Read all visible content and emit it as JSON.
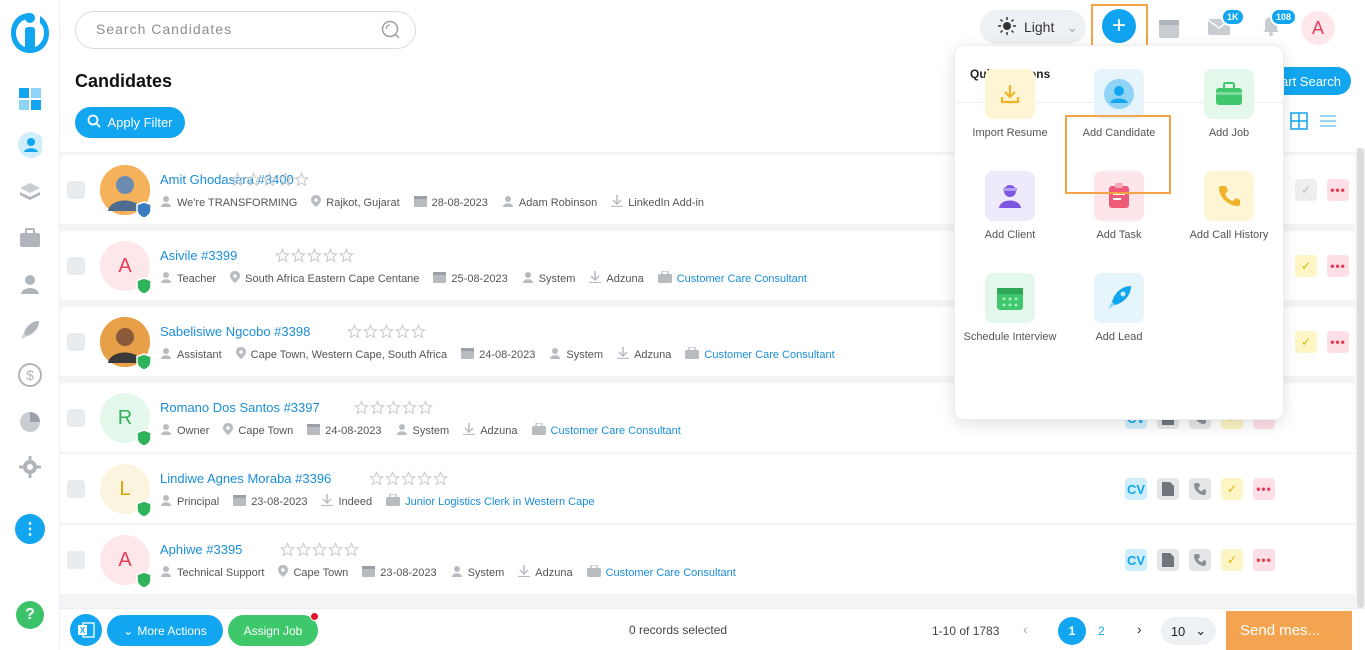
{
  "header": {
    "search_placeholder": "Search Candidates",
    "theme_label": "Light",
    "mail_badge": "1K",
    "notif_badge": "108",
    "avatar_letter": "A"
  },
  "page": {
    "title": "Candidates",
    "apply_filter": "Apply Filter",
    "smart_search": "Smart Search"
  },
  "quick_actions": {
    "title": "Quick Actions",
    "items": [
      {
        "label": "Import Resume",
        "icon": "download-icon",
        "bg": "#fdf5d3"
      },
      {
        "label": "Add Candidate",
        "icon": "user-icon",
        "bg": "#e6f5fc"
      },
      {
        "label": "Add Job",
        "icon": "briefcase-icon",
        "bg": "#e3f7ea"
      },
      {
        "label": "Add Client",
        "icon": "client-icon",
        "bg": "#eeeafb"
      },
      {
        "label": "Add Task",
        "icon": "clipboard-icon",
        "bg": "#fde5ea"
      },
      {
        "label": "Add Call History",
        "icon": "phone-icon",
        "bg": "#fdf5d3"
      },
      {
        "label": "Schedule Interview",
        "icon": "calendar-icon",
        "bg": "#e3f7ea"
      },
      {
        "label": "Add Lead",
        "icon": "rocket-icon",
        "bg": "#e6f5fc"
      }
    ]
  },
  "candidates": [
    {
      "name": "Amit Ghodasara #3400",
      "initial": "",
      "title": "We're TRANSFORMING",
      "location": "Rajkot, Gujarat",
      "date": "28-08-2023",
      "owner": "Adam Robinson",
      "source": "LinkedIn Add-in",
      "job": ""
    },
    {
      "name": "Asivile #3399",
      "initial": "A",
      "title": "Teacher",
      "location": "South Africa Eastern Cape Centane",
      "date": "25-08-2023",
      "owner": "System",
      "source": "Adzuna",
      "job": "Customer Care Consultant"
    },
    {
      "name": "Sabelisiwe Ngcobo #3398",
      "initial": "",
      "title": "Assistant",
      "location": "Cape Town, Western Cape, South Africa",
      "date": "24-08-2023",
      "owner": "System",
      "source": "Adzuna",
      "job": "Customer Care Consultant"
    },
    {
      "name": "Romano Dos Santos #3397",
      "initial": "R",
      "title": "Owner",
      "location": "Cape Town",
      "date": "24-08-2023",
      "owner": "System",
      "source": "Adzuna",
      "job": "Customer Care Consultant"
    },
    {
      "name": "Lindiwe Agnes Moraba #3396",
      "initial": "L",
      "title": "Principal",
      "location": "",
      "date": "23-08-2023",
      "owner": "",
      "source": "Indeed",
      "job": "Junior Logistics Clerk in Western Cape"
    },
    {
      "name": "Aphiwe #3395",
      "initial": "A",
      "title": "Technical Support",
      "location": "Cape Town",
      "date": "23-08-2023",
      "owner": "System",
      "source": "Adzuna",
      "job": "Customer Care Consultant"
    }
  ],
  "row_actions": {
    "cv": "CV",
    "more": "•••"
  },
  "footer": {
    "more_actions": "More Actions",
    "assign_job": "Assign Job",
    "records_selected": "0 records selected",
    "range": "1-10 of 1783",
    "page_1": "1",
    "page_2": "2",
    "per_page": "10",
    "send_message": "Send mes..."
  }
}
